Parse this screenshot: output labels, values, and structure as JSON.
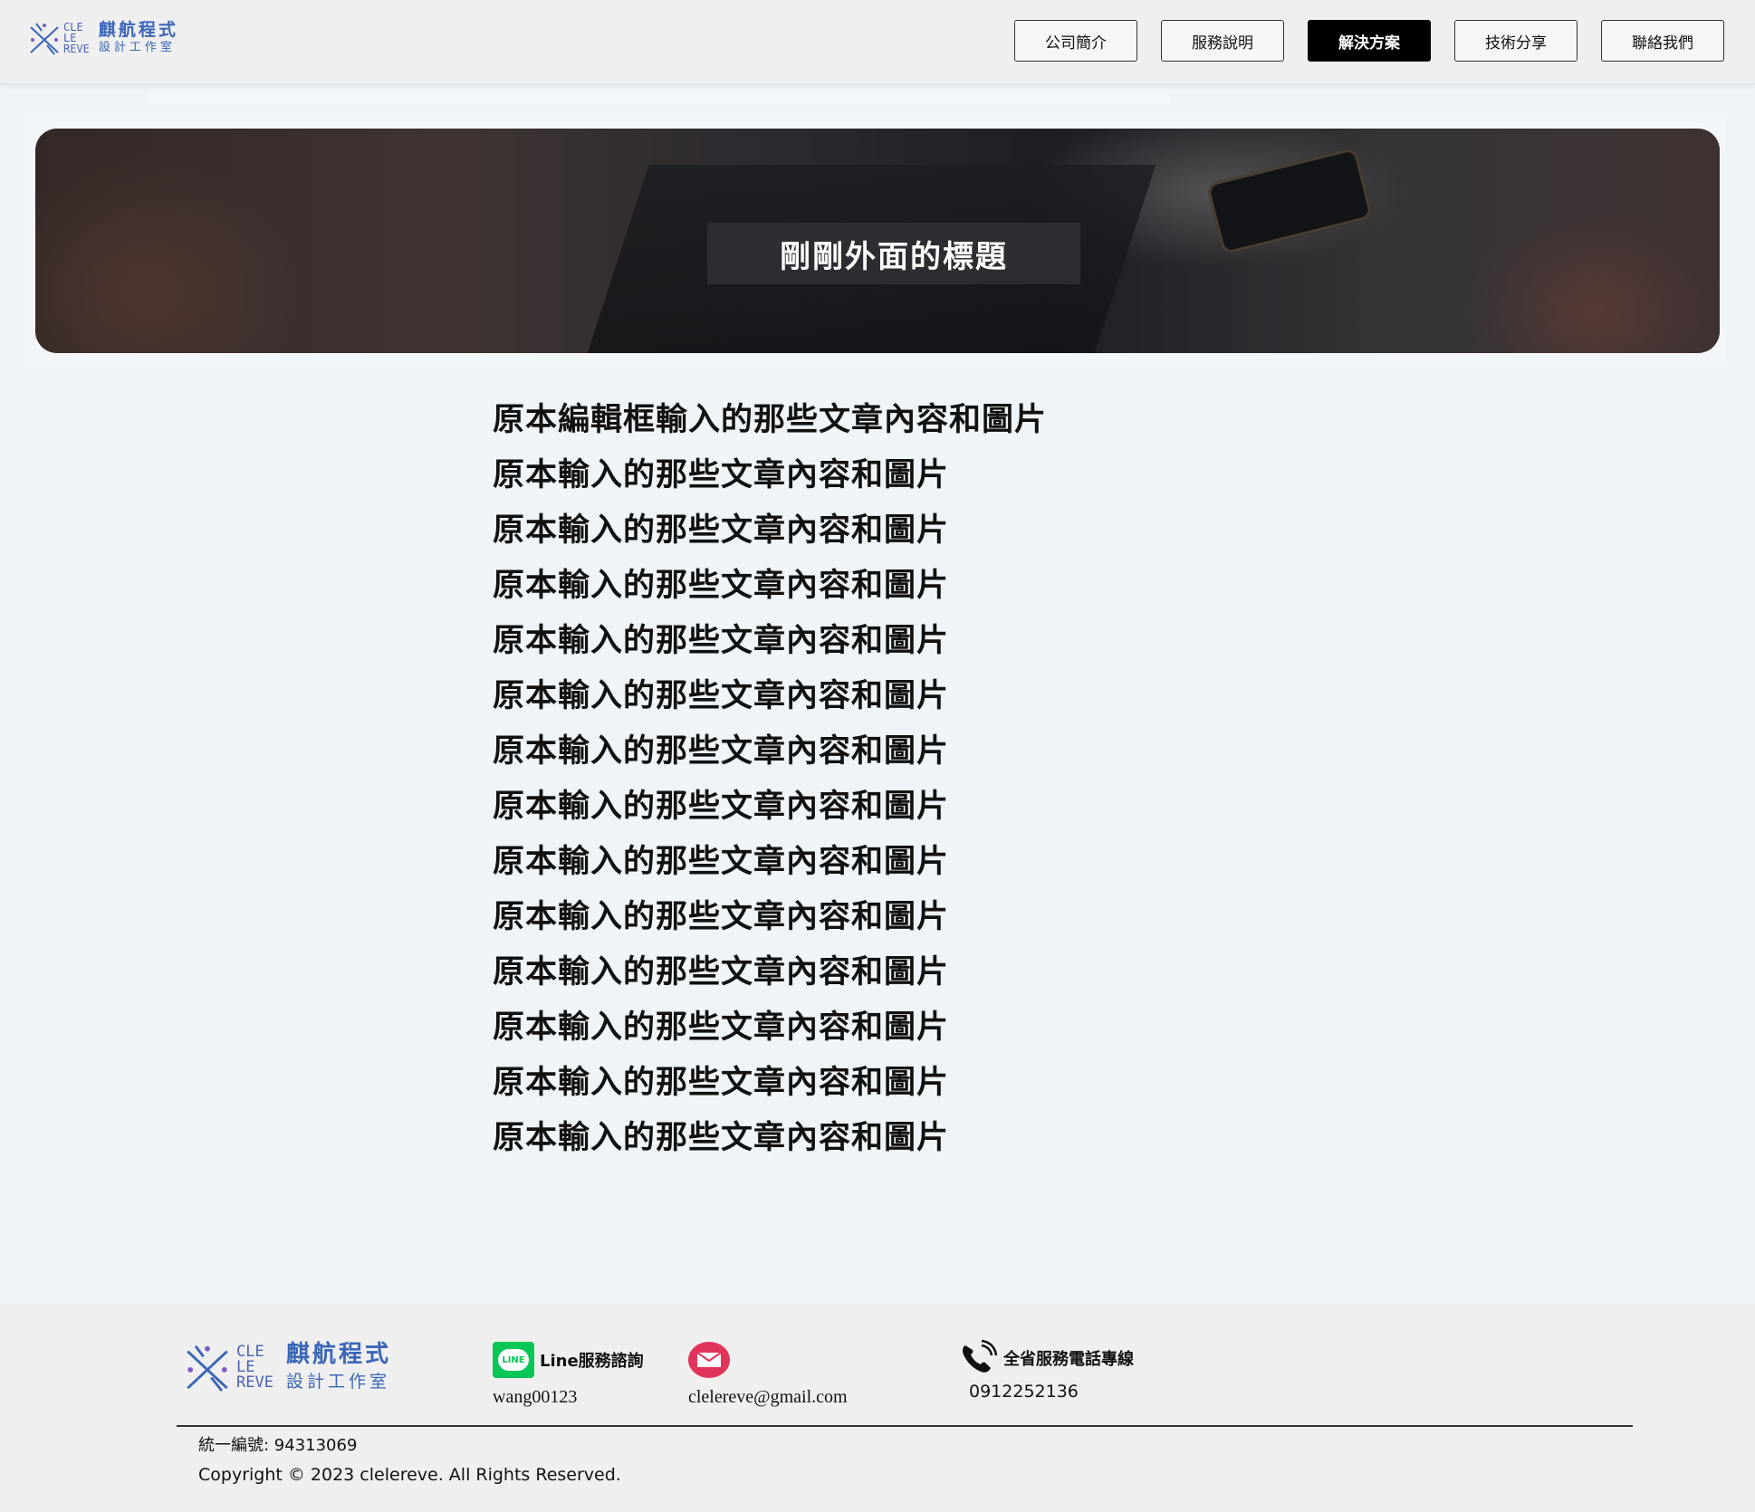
{
  "brand": {
    "name": "麒航程式",
    "subtitle": "設計工作室",
    "logo_letters": [
      "CLE",
      "LE",
      "REVE"
    ]
  },
  "nav": {
    "items": [
      {
        "label": "公司簡介",
        "active": false
      },
      {
        "label": "服務說明",
        "active": false
      },
      {
        "label": "解決方案",
        "active": true
      },
      {
        "label": "技術分享",
        "active": false
      },
      {
        "label": "聯絡我們",
        "active": false
      }
    ]
  },
  "banner": {
    "title": "剛剛外面的標題"
  },
  "content": {
    "lines": [
      "原本編輯框輸入的那些文章內容和圖片",
      "原本輸入的那些文章內容和圖片",
      "原本輸入的那些文章內容和圖片",
      "原本輸入的那些文章內容和圖片",
      "原本輸入的那些文章內容和圖片",
      "原本輸入的那些文章內容和圖片",
      "原本輸入的那些文章內容和圖片",
      "原本輸入的那些文章內容和圖片",
      "原本輸入的那些文章內容和圖片",
      "原本輸入的那些文章內容和圖片",
      "原本輸入的那些文章內容和圖片",
      "原本輸入的那些文章內容和圖片",
      "原本輸入的那些文章內容和圖片",
      "原本輸入的那些文章內容和圖片"
    ]
  },
  "footer": {
    "line": {
      "label": "Line服務諮詢",
      "value": "wang00123",
      "icon": "line-icon",
      "icon_text": "LINE"
    },
    "email": {
      "value": "clelereve@gmail.com",
      "icon": "mail-icon"
    },
    "phone": {
      "label": "全省服務電話專線",
      "value": "0912252136",
      "icon": "phone-icon"
    },
    "tax_id": "統一編號: 94313069",
    "copyright": "Copyright © 2023 clelereve. All Rights Reserved."
  },
  "colors": {
    "brand_blue": "#3a66b8",
    "nav_active_bg": "#000000",
    "line_green": "#06c755",
    "mail_red": "#e2345a",
    "page_bg": "#eef4f8"
  }
}
